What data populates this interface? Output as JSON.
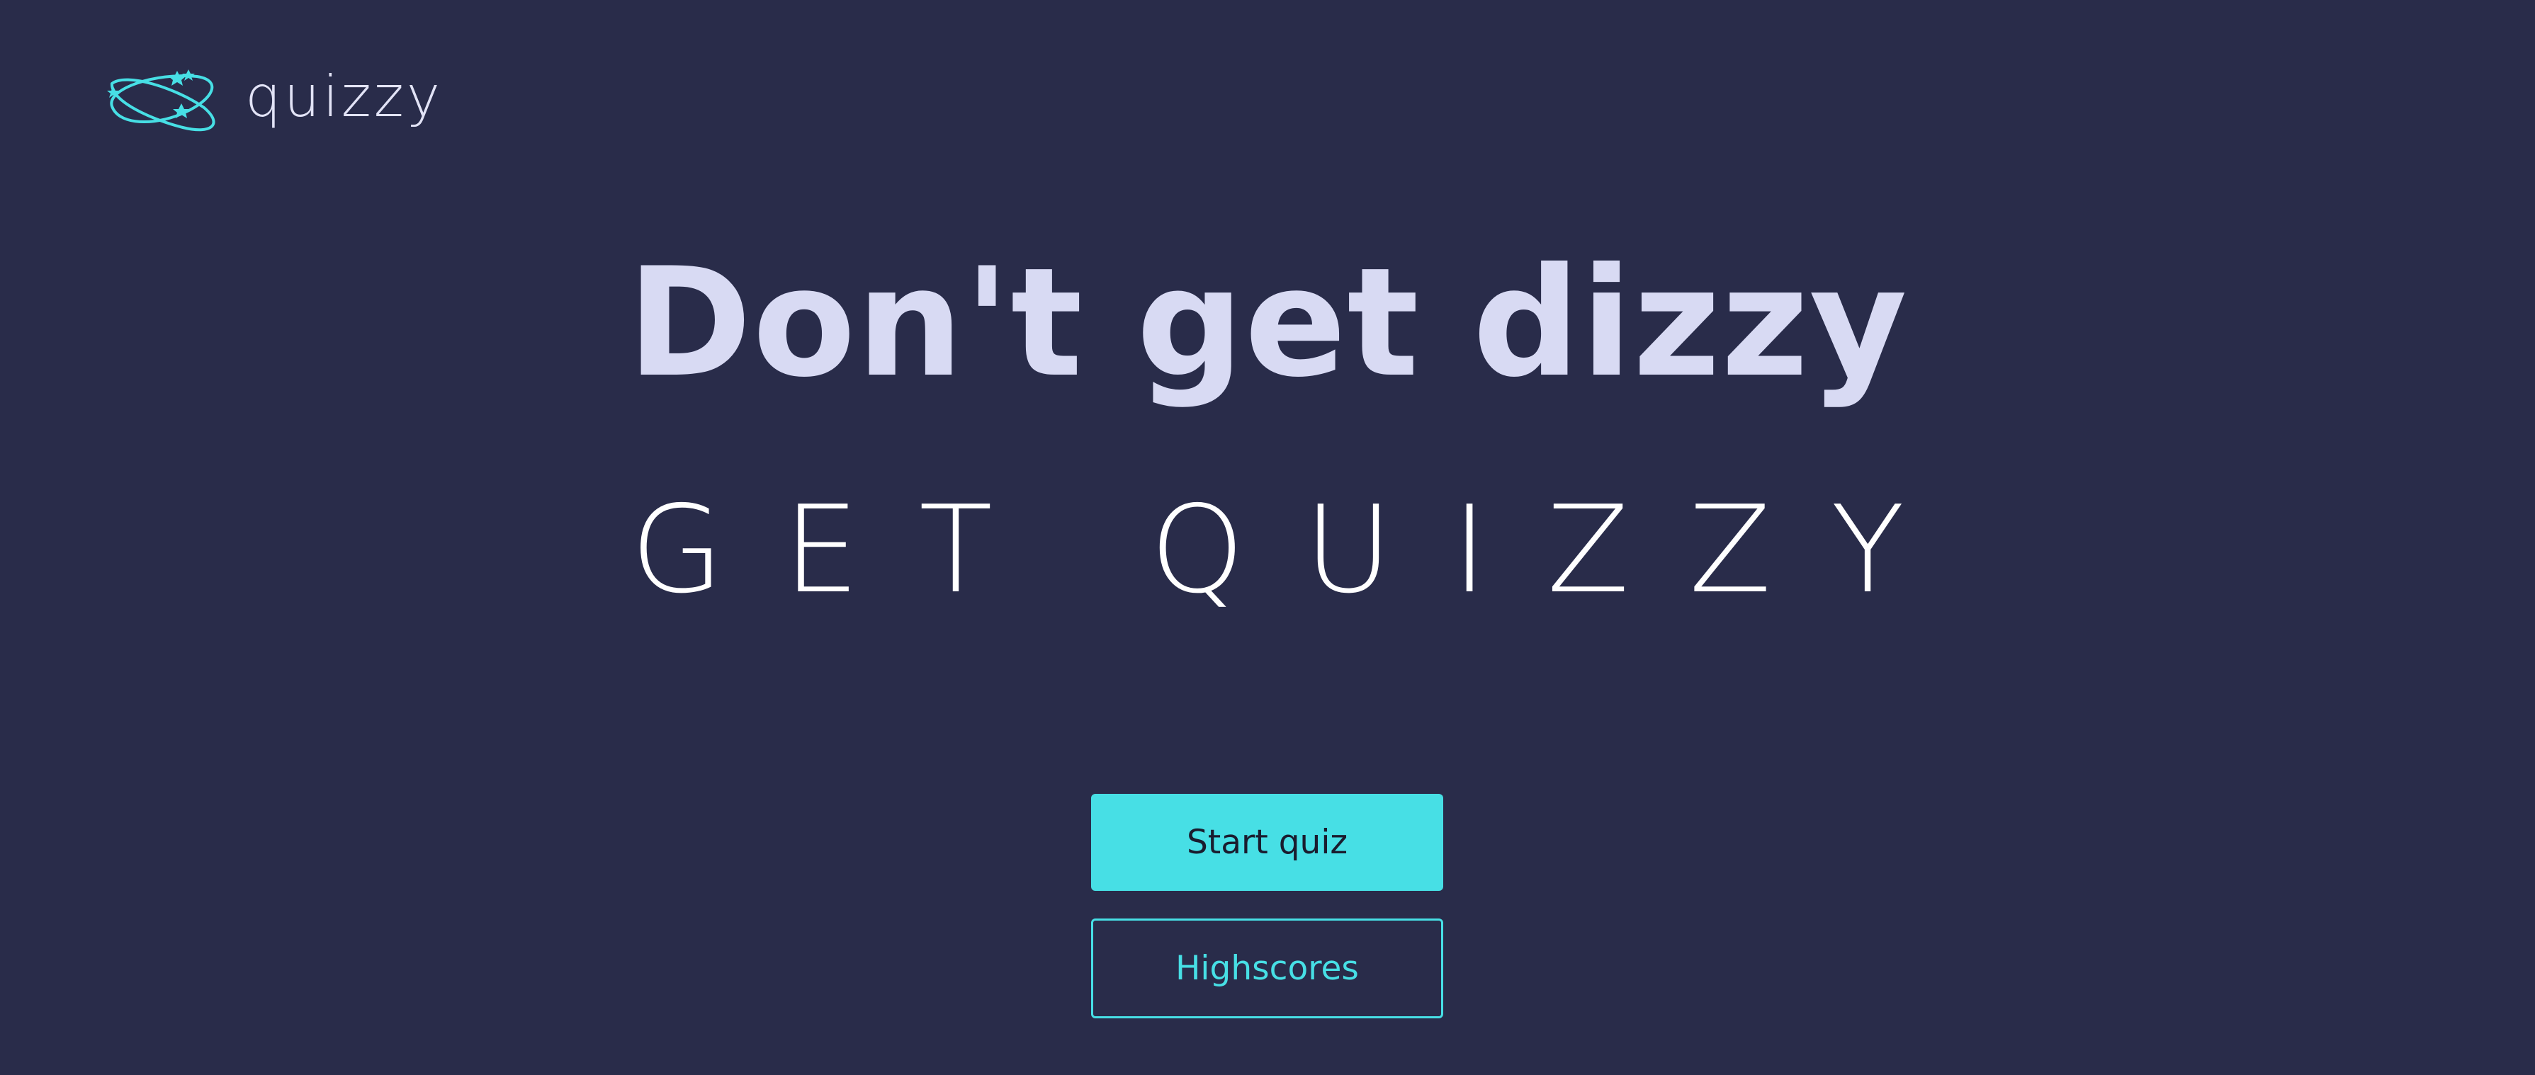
{
  "brand": {
    "name": "quizzy",
    "icon": "orbit-stars-icon",
    "accent_color": "#47dfe5"
  },
  "hero": {
    "headline": "Don't get dizzy",
    "subline": "GET QUIZZY"
  },
  "actions": {
    "start_label": "Start quiz",
    "highscores_label": "Highscores"
  },
  "colors": {
    "background": "#292c4a",
    "headline": "#d8daf3",
    "subline": "#ffffff"
  }
}
